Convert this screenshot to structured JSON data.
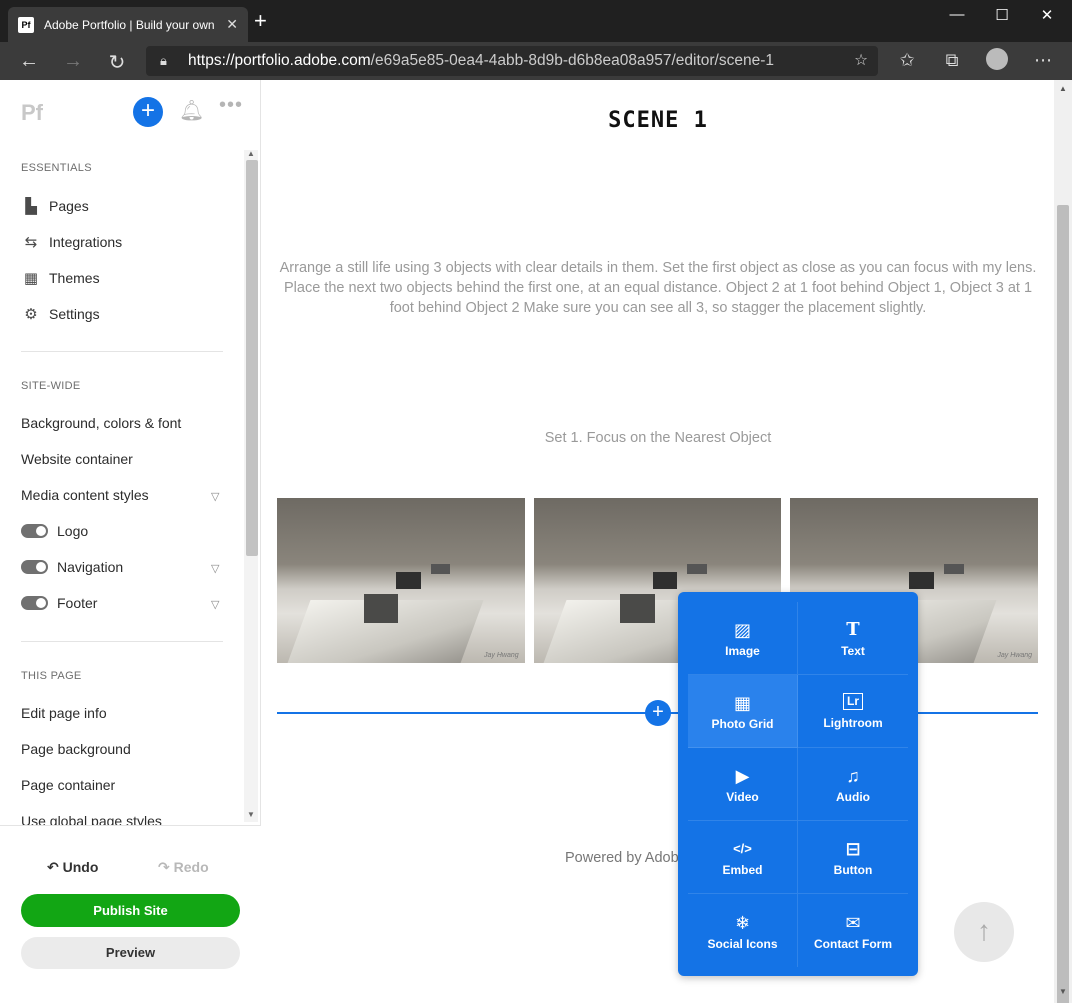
{
  "browser": {
    "tab_favicon": "Pf",
    "tab_title": "Adobe Portfolio | Build your own",
    "tab_close": "✕",
    "new_tab": "+",
    "url_host": "https://portfolio.adobe.com",
    "url_path": "/e69a5e85-0ea4-4abb-8d9b-d6b8ea08a957/editor/scene-1"
  },
  "sidebar": {
    "logo": "Pf",
    "plus": "+",
    "essentials_head": "ESSENTIALS",
    "essentials": [
      "Pages",
      "Integrations",
      "Themes",
      "Settings"
    ],
    "sitewide_head": "SITE-WIDE",
    "sitewide": [
      "Background, colors & font",
      "Website container",
      "Media content styles",
      "Logo",
      "Navigation",
      "Footer"
    ],
    "thispage_head": "THIS PAGE",
    "thispage": [
      "Edit page info",
      "Page background",
      "Page container",
      "Use global page styles"
    ],
    "undo": "Undo",
    "redo": "Redo",
    "publish": "Publish Site",
    "preview": "Preview"
  },
  "canvas": {
    "title": "SCENE 1",
    "description": "Arrange a still life using 3 objects with clear details in them. Set the first object as close as you can focus with my lens. Place the next two objects behind the first one, at an equal distance. Object 2 at 1 foot behind Object 1, Object 3 at 1 foot behind Object 2 Make sure you can see all 3, so stagger the placement slightly.",
    "set_label": "Set 1. Focus on the Nearest Object",
    "watermark": "Jay Hwang",
    "insert_plus": "+",
    "powered": "Powered by Adob"
  },
  "popover": {
    "items": [
      "Image",
      "Text",
      "Photo Grid",
      "Lightroom",
      "Video",
      "Audio",
      "Embed",
      "Button",
      "Social Icons",
      "Contact Form"
    ],
    "icons": [
      "▨",
      "T",
      "▦",
      "Lr",
      "▶",
      "♫",
      "</>",
      "⊟",
      "❄",
      "✉"
    ],
    "active": "Photo Grid"
  },
  "colors": {
    "accent": "#1473e6",
    "publish": "#12a614"
  }
}
